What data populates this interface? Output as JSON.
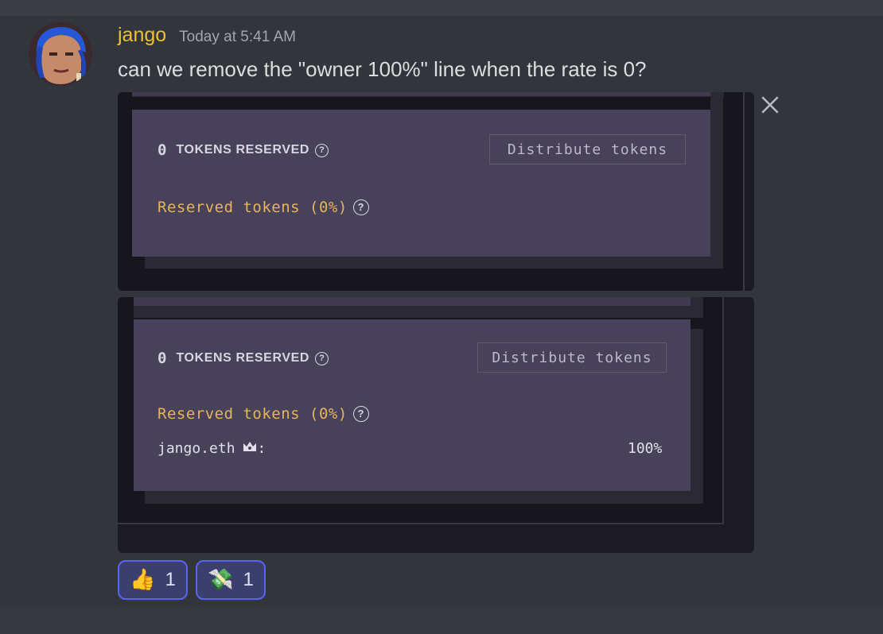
{
  "message": {
    "username": "jango",
    "timestamp": "Today at 5:41 AM",
    "text": "can we remove the \"owner 100%\" line when the rate is 0?"
  },
  "attachment_1": {
    "tokens_count": "0",
    "tokens_label": "TOKENS RESERVED",
    "distribute_button": "Distribute tokens",
    "reserved_line": "Reserved tokens (0%)"
  },
  "attachment_2": {
    "tokens_count": "0",
    "tokens_label": "TOKENS RESERVED",
    "distribute_button": "Distribute tokens",
    "reserved_line": "Reserved tokens (0%)",
    "owner_name": "jango.eth",
    "owner_suffix": ":",
    "owner_percent": "100%"
  },
  "reactions": [
    {
      "emoji": "👍",
      "count": "1"
    },
    {
      "emoji": "💸",
      "count": "1"
    }
  ],
  "colors": {
    "username": "#f0c033",
    "reserved_accent": "#e8b45a",
    "reaction_border": "#5865f2",
    "panel": "#474159"
  },
  "icons": {
    "close": "close-icon",
    "help": "question-circle-icon",
    "crown": "crown-icon"
  }
}
